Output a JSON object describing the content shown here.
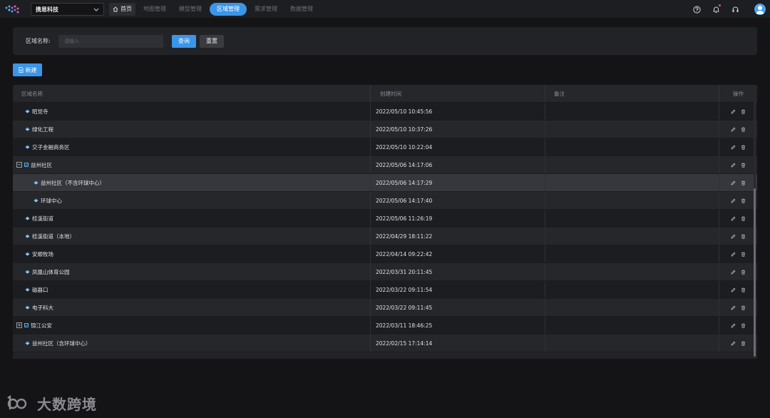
{
  "org_selector": {
    "value": "携恩科技"
  },
  "nav": {
    "home": "首页",
    "items": [
      "地图管理",
      "模型管理",
      "区域管理",
      "需求管理",
      "数据管理"
    ],
    "active_index": 2
  },
  "search": {
    "label": "区域名称:",
    "placeholder": "请输入",
    "query_label": "查询",
    "reset_label": "重置"
  },
  "new_button": {
    "label": "新建"
  },
  "table": {
    "columns": [
      "区域名称",
      "创建时间",
      "备注",
      "操作"
    ],
    "rows": [
      {
        "name": "昭觉寺",
        "time": "2022/05/10 10:45:56",
        "note": "",
        "level": 1,
        "expand": ""
      },
      {
        "name": "绿化工程",
        "time": "2022/05/10 10:37:26",
        "note": "",
        "level": 1,
        "expand": ""
      },
      {
        "name": "交子金融商务区",
        "time": "2022/05/10 10:22:04",
        "note": "",
        "level": 1,
        "expand": ""
      },
      {
        "name": "益州社区",
        "time": "2022/05/06 14:17:06",
        "note": "",
        "level": 0,
        "expand": "−"
      },
      {
        "name": "益州社区（不含环球中心）",
        "time": "2022/05/06 14:17:29",
        "note": "",
        "level": 2,
        "expand": ""
      },
      {
        "name": "环球中心",
        "time": "2022/05/06 14:17:40",
        "note": "",
        "level": 2,
        "expand": ""
      },
      {
        "name": "桂溪街道",
        "time": "2022/05/06 11:26:19",
        "note": "",
        "level": 1,
        "expand": ""
      },
      {
        "name": "桂溪街道（本地）",
        "time": "2022/04/29 18:11:22",
        "note": "",
        "level": 1,
        "expand": ""
      },
      {
        "name": "安顺牧场",
        "time": "2022/04/14 09:22:42",
        "note": "",
        "level": 1,
        "expand": ""
      },
      {
        "name": "凤凰山体育公园",
        "time": "2022/03/31 20:11:45",
        "note": "",
        "level": 1,
        "expand": ""
      },
      {
        "name": "磁器口",
        "time": "2022/03/22 09:11:54",
        "note": "",
        "level": 1,
        "expand": ""
      },
      {
        "name": "电子科大",
        "time": "2022/03/22 09:11:45",
        "note": "",
        "level": 1,
        "expand": ""
      },
      {
        "name": "锦江公安",
        "time": "2022/03/11 18:46:25",
        "note": "",
        "level": 0,
        "expand": "+"
      },
      {
        "name": "益州社区（含环球中心）",
        "time": "2022/02/15 17:14:14",
        "note": "",
        "level": 1,
        "expand": ""
      }
    ]
  },
  "watermark": {
    "text": "大数跨境"
  },
  "colors": {
    "accent": "#3b95e8",
    "bg": "#141416",
    "panel": "#222327"
  }
}
